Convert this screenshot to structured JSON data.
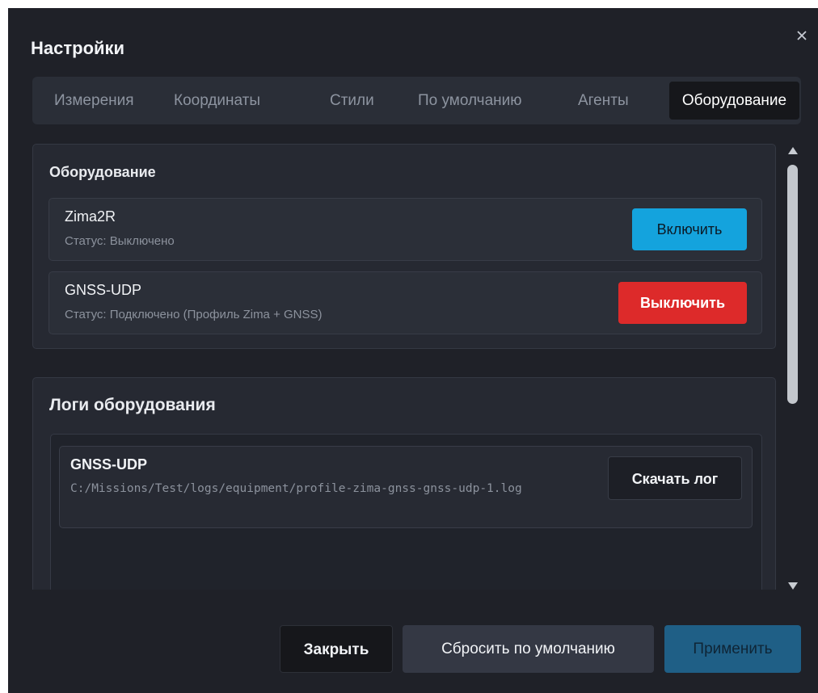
{
  "dialog": {
    "title": "Настройки",
    "close_icon": "close-icon"
  },
  "tabs": [
    {
      "label": "Измерения",
      "active": false
    },
    {
      "label": "Координаты",
      "active": false
    },
    {
      "label": "Стили",
      "active": false
    },
    {
      "label": "По умолчанию",
      "active": false
    },
    {
      "label": "Агенты",
      "active": false
    },
    {
      "label": "Оборудование",
      "active": true
    }
  ],
  "equipment": {
    "title": "Оборудование",
    "devices": [
      {
        "name": "Zima2R",
        "status": "Статус: Выключено",
        "action": "Включить"
      },
      {
        "name": "GNSS-UDP",
        "status": "Статус: Подключено (Профиль Zima + GNSS)",
        "action": "Выключить"
      }
    ]
  },
  "logs": {
    "title": "Логи оборудования",
    "entries": [
      {
        "name": "GNSS-UDP",
        "path": "C:/Missions/Test/logs/equipment/profile-zima-gnss-gnss-udp-1.log",
        "action": "Скачать лог"
      }
    ]
  },
  "footer": {
    "close": "Закрыть",
    "reset": "Сбросить по умолчанию",
    "apply": "Применить"
  },
  "colors": {
    "background": "#1f2128",
    "enable_button": "#14a3dd",
    "disable_button": "#dd2a2a",
    "apply_button": "#1f5f86"
  }
}
